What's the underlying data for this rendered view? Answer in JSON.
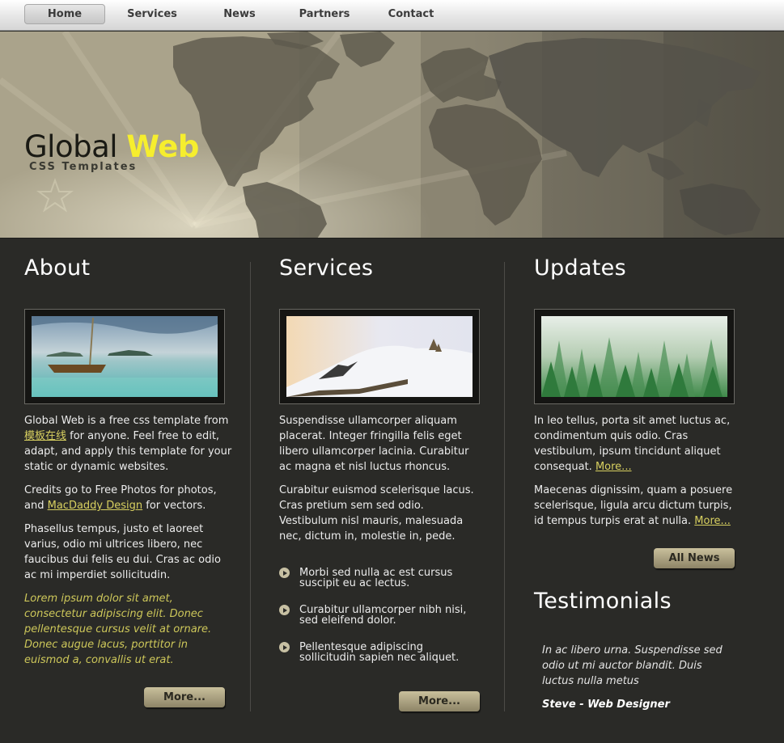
{
  "nav": {
    "items": [
      {
        "label": "Home",
        "active": true
      },
      {
        "label": "Services",
        "active": false
      },
      {
        "label": "News",
        "active": false
      },
      {
        "label": "Partners",
        "active": false
      },
      {
        "label": "Contact",
        "active": false
      }
    ]
  },
  "header": {
    "logo_main": "Global",
    "logo_accent": "Web",
    "tagline": "CSS Templates"
  },
  "about": {
    "title": "About",
    "p1_before": "Global Web is a free css template from",
    "p1_link": "模板在线",
    "p1_after": "for anyone. Feel free to edit, adapt, and apply this template for your static or dynamic websites.",
    "p2_before": "Credits go to Free Photos for photos, and",
    "p2_link": "MacDaddy Design",
    "p2_after": "for vectors.",
    "p3": "Phasellus tempus, justo et laoreet varius, odio mi ultrices libero, nec faucibus dui felis eu dui. Cras ac odio ac mi imperdiet sollicitudin.",
    "p4": "Lorem ipsum dolor sit amet, consectetur adipiscing elit. Donec pellentesque cursus velit at ornare. Donec augue lacus, porttitor in euismod a, convallis ut erat.",
    "button": "More..."
  },
  "services": {
    "title": "Services",
    "p1": "Suspendisse ullamcorper aliquam placerat. Integer fringilla felis eget libero ullamcorper lacinia. Curabitur ac magna et nisl luctus rhoncus.",
    "p2": "Curabitur euismod scelerisque lacus. Cras pretium sem sed odio. Vestibulum nisl mauris, malesuada nec, dictum in, molestie in, pede.",
    "bullets": [
      "Morbi sed nulla ac est cursus suscipit eu ac lectus.",
      "Curabitur ullamcorper nibh nisi, sed eleifend dolor.",
      "Pellentesque adipiscing sollicitudin sapien nec aliquet."
    ],
    "button": "More..."
  },
  "updates": {
    "title": "Updates",
    "p1": "In leo tellus, porta sit amet luctus ac, condimentum quis odio. Cras vestibulum, ipsum tincidunt aliquet consequat.",
    "p1_link": "More...",
    "p2": "Maecenas dignissim, quam a posuere scelerisque, ligula arcu dictum turpis, id tempus turpis erat at nulla.",
    "p2_link": "More...",
    "button": "All News"
  },
  "testimonials": {
    "title": "Testimonials",
    "quote": "In ac libero urna. Suspendisse sed odio ut mi auctor blandit. Duis luctus nulla metus",
    "author": "Steve - Web Designer"
  },
  "colors": {
    "accent_yellow": "#f6ee2e",
    "link": "#d8d060",
    "background": "#2a2a27",
    "button": "#a89f80"
  }
}
